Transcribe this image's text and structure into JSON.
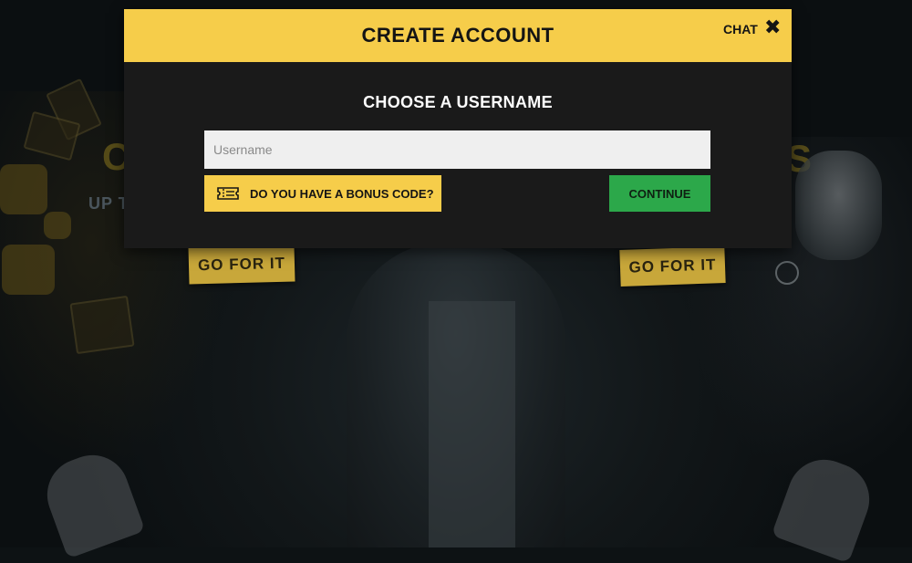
{
  "modal": {
    "title": "CREATE ACCOUNT",
    "chat_label": "CHAT",
    "close_icon": "close-icon",
    "subtitle": "CHOOSE A USERNAME",
    "username_placeholder": "Username",
    "username_value": "",
    "bonus_code_label": "DO YOU HAVE A BONUS CODE?",
    "bonus_icon": "ticket-icon",
    "continue_label": "CONTINUE"
  },
  "background": {
    "left_promo_heading": "C",
    "left_promo_sub": "UP T",
    "right_promo_heading": "S",
    "left_cta": "GO FOR IT",
    "right_cta": "GO FOR IT"
  },
  "colors": {
    "accent_yellow": "#f6cd4a",
    "continue_green": "#2ca84a",
    "modal_body": "#1a1a1a",
    "input_bg": "#efefef"
  }
}
